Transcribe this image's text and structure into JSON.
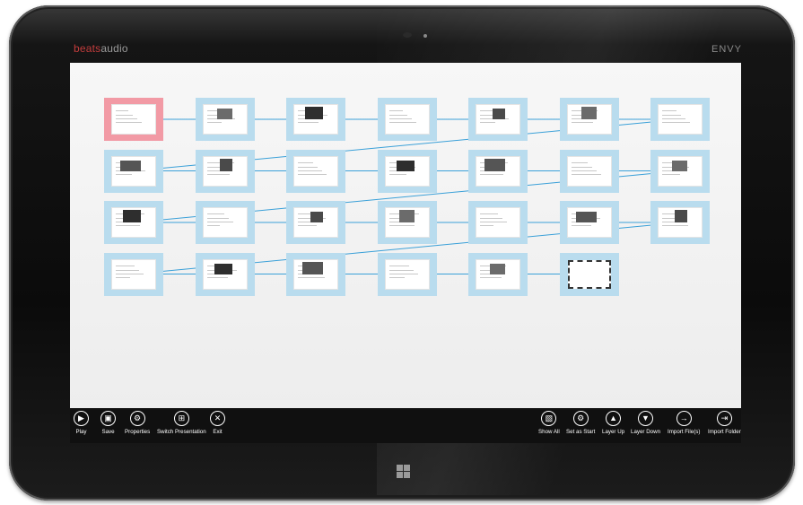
{
  "device": {
    "brand_left": "beats",
    "brand_right": "audio",
    "model": "ENVY"
  },
  "slides": {
    "count": 27,
    "start_index": 0,
    "last_index": 26
  },
  "appbar": {
    "left": [
      {
        "label": "Play",
        "icon": "play-icon"
      },
      {
        "label": "Save",
        "icon": "save-icon"
      },
      {
        "label": "Properties",
        "icon": "gear-icon"
      },
      {
        "label": "Switch Presentation",
        "icon": "grid-icon"
      },
      {
        "label": "Exit",
        "icon": "close-icon"
      }
    ],
    "right": [
      {
        "label": "Show All",
        "icon": "show-all-icon"
      },
      {
        "label": "Set as Start",
        "icon": "gear-icon"
      },
      {
        "label": "Layer Up",
        "icon": "layer-up-icon"
      },
      {
        "label": "Layer Down",
        "icon": "layer-down-icon"
      },
      {
        "label": "Import File(s)",
        "icon": "import-file-icon"
      },
      {
        "label": "Import Folder",
        "icon": "import-folder-icon"
      }
    ]
  },
  "colors": {
    "slide_frame": "#b9dcee",
    "start_frame": "#f29aa5",
    "connector": "#3aa0d8",
    "appbar": "#101010"
  }
}
